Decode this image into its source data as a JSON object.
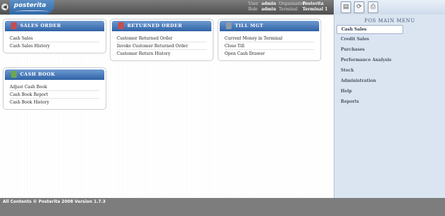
{
  "header": {
    "back_glyph": "◀",
    "logo": "posterita",
    "user_label": "User",
    "user_value": "admin",
    "org_label": "Organisation",
    "org_value": "Posterita",
    "role_label": "Role",
    "role_value": "admin",
    "terminal_label": "Terminal",
    "terminal_value": "Terminal 1"
  },
  "toolbar": {
    "buttons": [
      {
        "icon": "document-icon",
        "glyph": "▤"
      },
      {
        "icon": "refresh-icon",
        "glyph": "⟳"
      },
      {
        "icon": "print-icon",
        "glyph": "⎙"
      }
    ]
  },
  "panels": {
    "sales_order": {
      "title": "SALES ORDER",
      "icon_color": "#c94c4c",
      "items": [
        "Cash Sales",
        "Cash Sales History"
      ]
    },
    "returned_order": {
      "title": "RETURNED ORDER",
      "icon_color": "#c94c4c",
      "items": [
        "Customer Returned Order",
        "Invoke Customer Returned Order",
        "Customer Return History"
      ]
    },
    "till_mgt": {
      "title": "TILL MGT",
      "icon_color": "#8e9aa8",
      "items": [
        "Current Money in Terminal",
        "Close Till",
        "Open Cash Drawer"
      ]
    },
    "cash_book": {
      "title": "CASH BOOK",
      "icon_color": "#6aa84f",
      "items": [
        "Adjust Cash Book",
        "Cash Book Report",
        "Cash Book History"
      ]
    }
  },
  "side_menu": {
    "title": "POS MAIN MENU",
    "items": [
      "Cash Sales",
      "Credit Sales",
      "Purchases",
      "Performance Analysis",
      "Stock",
      "Administration",
      "Help",
      "Reports"
    ],
    "active_index": 0
  },
  "footer": {
    "text": "All Contents © Posterita 2008 Version 1.7.3"
  }
}
